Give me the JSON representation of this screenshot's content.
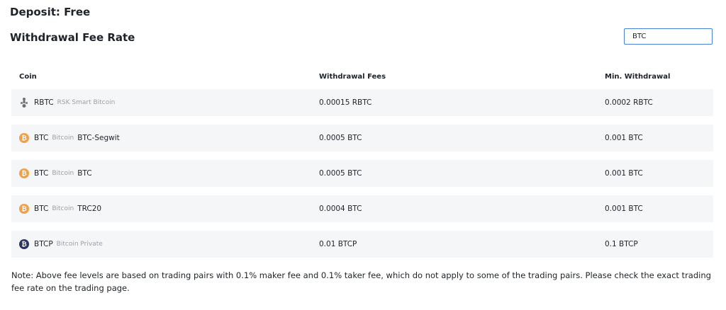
{
  "deposit_label": "Deposit: Free",
  "section_title": "Withdrawal Fee Rate",
  "search": {
    "value": "BTC",
    "placeholder": ""
  },
  "table": {
    "headers": {
      "coin": "Coin",
      "fees": "Withdrawal Fees",
      "min": "Min. Withdrawal"
    },
    "rows": [
      {
        "icon": "rbtc-icon",
        "symbol": "RBTC",
        "name": "RSK Smart Bitcoin",
        "network": "",
        "fee": "0.00015 RBTC",
        "min": "0.0002 RBTC"
      },
      {
        "icon": "btc-icon",
        "symbol": "BTC",
        "name": "Bitcoin",
        "network": "BTC-Segwit",
        "fee": "0.0005 BTC",
        "min": "0.001 BTC"
      },
      {
        "icon": "btc-icon",
        "symbol": "BTC",
        "name": "Bitcoin",
        "network": "BTC",
        "fee": "0.0005 BTC",
        "min": "0.001 BTC"
      },
      {
        "icon": "btc-icon",
        "symbol": "BTC",
        "name": "Bitcoin",
        "network": "TRC20",
        "fee": "0.0004 BTC",
        "min": "0.001 BTC"
      },
      {
        "icon": "btcp-icon",
        "symbol": "BTCP",
        "name": "Bitcoin Private",
        "network": "",
        "fee": "0.01 BTCP",
        "min": "0.1 BTCP"
      }
    ]
  },
  "note": "Note: Above fee levels are based on trading pairs with 0.1% maker fee and 0.1% taker fee, which do not apply to some of the trading pairs. Please check the exact trading fee rate on the trading page.",
  "colors": {
    "row_bg": "#f5f6f8",
    "btc_icon": "#f0a046",
    "btcp_icon": "#2b3560",
    "search_border": "#4a7fd6",
    "muted_text": "#9aa0a6"
  }
}
